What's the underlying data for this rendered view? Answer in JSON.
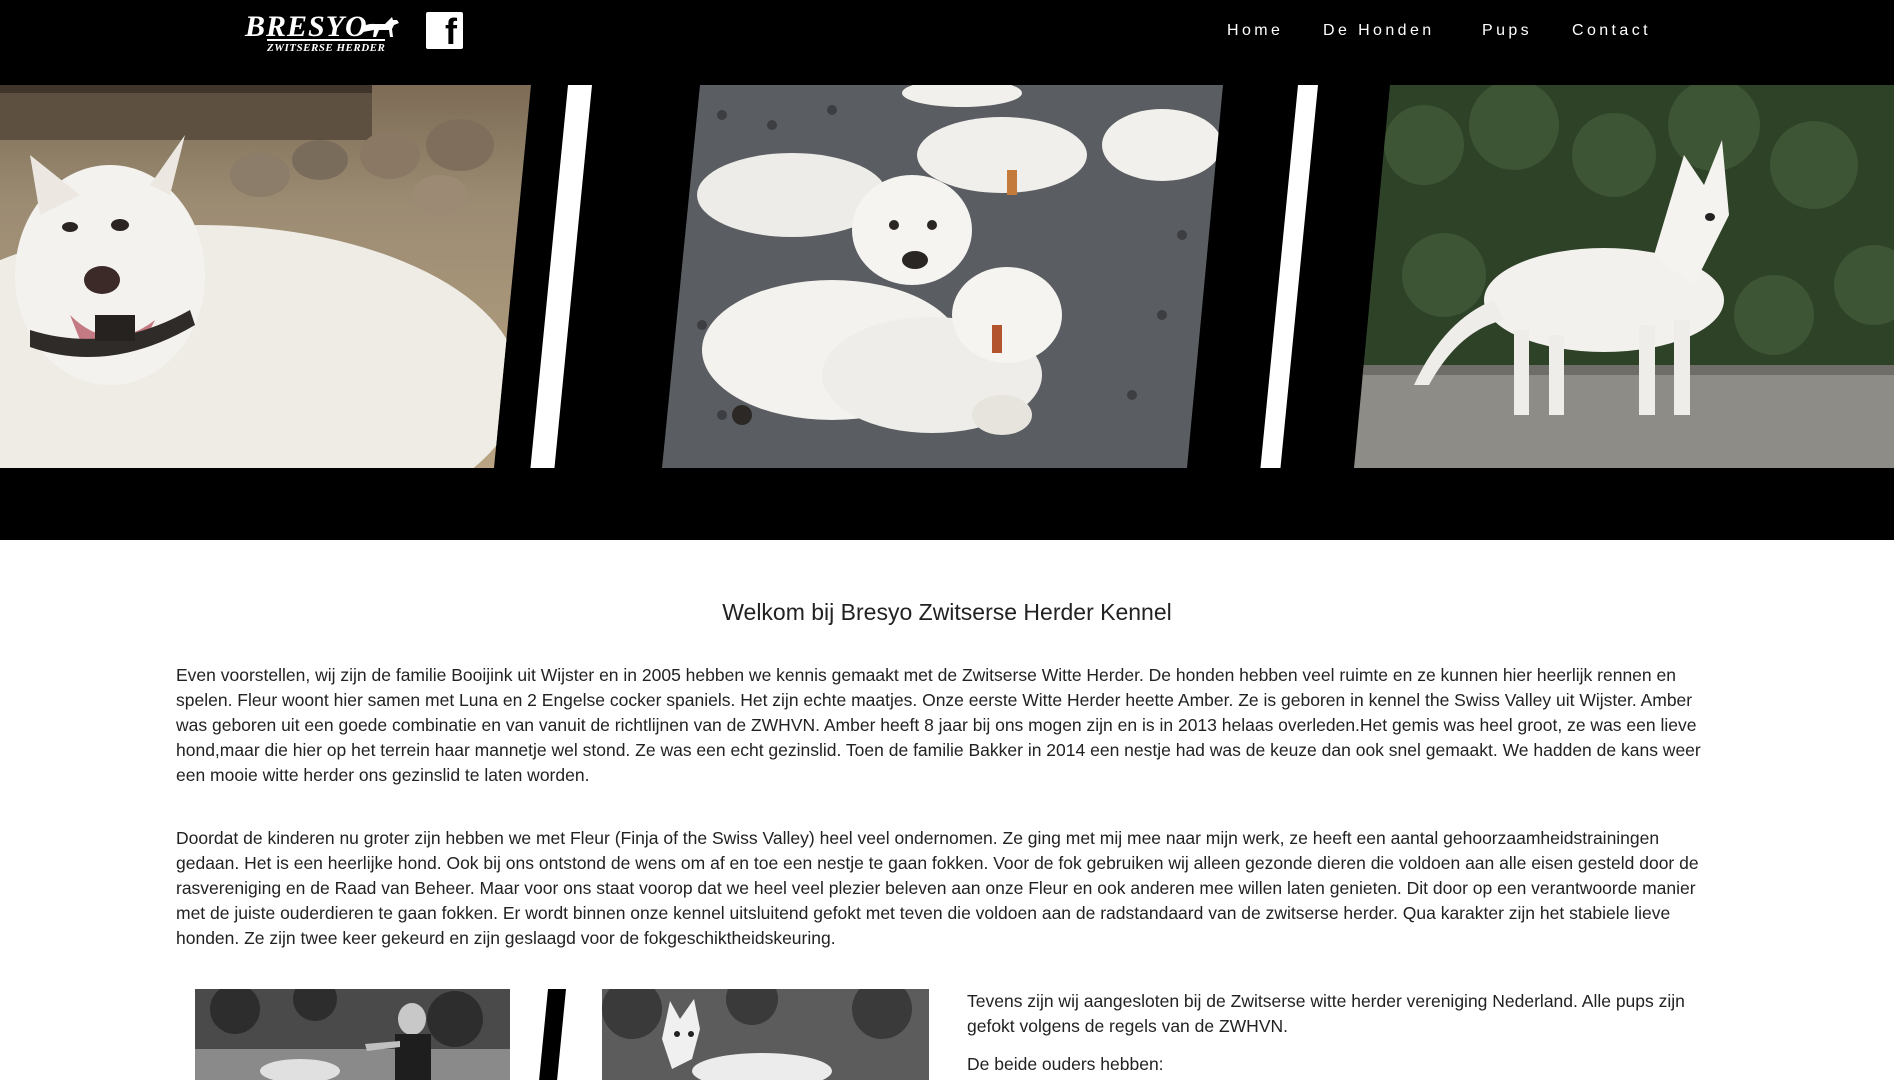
{
  "header": {
    "logo_main": "BRESYO",
    "logo_sub": "ZWITSERSE HERDER",
    "facebook_glyph": "f",
    "nav": [
      "Home",
      "De Honden",
      "Pups",
      "Contact"
    ]
  },
  "hero": {
    "images": [
      "dog-portrait-photo",
      "puppies-photo",
      "standing-dog-photo"
    ]
  },
  "main": {
    "title": "Welkom bij Bresyo Zwitserse Herder Kennel",
    "paragraph1": "Even voorstellen, wij zijn de familie Booijink uit Wijster en in 2005 hebben we kennis gemaakt met de Zwitserse Witte Herder. De honden hebben veel ruimte en ze kunnen hier heerlijk rennen en spelen. Fleur woont hier samen met Luna en 2 Engelse cocker spaniels. Het zijn echte maatjes. Onze eerste Witte Herder heette Amber. Ze is geboren in kennel the Swiss Valley uit Wijster. Amber was geboren uit een goede combinatie en van vanuit de richtlijnen van de ZWHVN. Amber heeft 8 jaar bij ons mogen zijn en is in 2013 helaas overleden.Het gemis was heel groot, ze was een lieve hond,maar die hier op het terrein haar mannetje wel stond. Ze was een echt gezinslid. Toen de familie Bakker in 2014 een nestje had was de keuze dan ook snel gemaakt. We hadden de kans weer een mooie witte herder ons gezinslid te laten worden.",
    "paragraph2": "Doordat de kinderen nu groter zijn hebben we met Fleur (Finja of the Swiss Valley) heel veel ondernomen. Ze ging met mij mee naar mijn werk, ze heeft een aantal gehoorzaamheidstrainingen gedaan. Het is een heerlijke hond. Ook bij ons ontstond de wens om af en toe een nestje te gaan fokken. Voor de fok gebruiken wij alleen gezonde dieren die voldoen aan alle eisen gesteld door de rasvereniging en de Raad van Beheer. Maar voor ons staat voorop dat we heel veel plezier beleven aan onze Fleur en ook anderen mee willen laten genieten. Dit door op een verantwoorde manier met de juiste ouderdieren te gaan fokken. Er wordt binnen onze kennel uitsluitend gefokt met teven die voldoen aan de radstandaard van de zwitserse herder. Qua karakter zijn het stabiele lieve honden. Ze zijn twee keer gekeurd en zijn geslaagd voor de fokgeschiktheidskeuring.",
    "side_text1": "Tevens zijn wij aangesloten bij de Zwitserse witte herder vereniging Nederland. Alle pups zijn gefokt volgens de regels van de ZWHVN.",
    "side_text2": "De beide ouders hebben:"
  }
}
